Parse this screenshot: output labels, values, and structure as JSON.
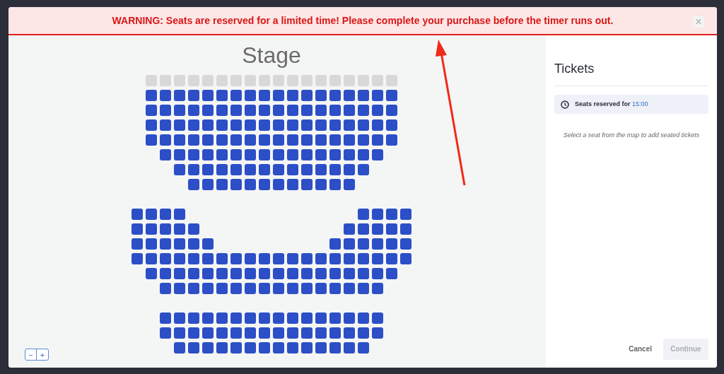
{
  "banner": {
    "message": "WARNING: Seats are reserved for a limited time! Please complete your purchase before the timer runs out.",
    "close": "×"
  },
  "seat_map": {
    "title": "Stage",
    "sections": [
      {
        "rows": [
          [
            {
              "kind": "seat",
              "available": false
            },
            {
              "kind": "seat",
              "available": false
            },
            {
              "kind": "seat",
              "available": false
            },
            {
              "kind": "seat",
              "available": false
            },
            {
              "kind": "seat",
              "available": false
            },
            {
              "kind": "seat",
              "available": false
            },
            {
              "kind": "seat",
              "available": false
            },
            {
              "kind": "seat",
              "available": false
            },
            {
              "kind": "seat",
              "available": false
            },
            {
              "kind": "seat",
              "available": false
            },
            {
              "kind": "seat",
              "available": false
            },
            {
              "kind": "seat",
              "available": false
            },
            {
              "kind": "seat",
              "available": false
            },
            {
              "kind": "seat",
              "available": false
            },
            {
              "kind": "seat",
              "available": false
            },
            {
              "kind": "seat",
              "available": false
            },
            {
              "kind": "seat",
              "available": false
            },
            {
              "kind": "seat",
              "available": false
            }
          ],
          [
            {
              "kind": "seat",
              "available": true
            },
            {
              "kind": "seat",
              "available": true
            },
            {
              "kind": "seat",
              "available": true
            },
            {
              "kind": "seat",
              "available": true
            },
            {
              "kind": "seat",
              "available": true
            },
            {
              "kind": "seat",
              "available": true
            },
            {
              "kind": "seat",
              "available": true
            },
            {
              "kind": "seat",
              "available": true
            },
            {
              "kind": "seat",
              "available": true
            },
            {
              "kind": "seat",
              "available": true
            },
            {
              "kind": "seat",
              "available": true
            },
            {
              "kind": "seat",
              "available": true
            },
            {
              "kind": "seat",
              "available": true
            },
            {
              "kind": "seat",
              "available": true
            },
            {
              "kind": "seat",
              "available": true
            },
            {
              "kind": "seat",
              "available": true
            },
            {
              "kind": "seat",
              "available": true
            },
            {
              "kind": "seat",
              "available": true
            }
          ],
          [
            {
              "kind": "seat",
              "available": true
            },
            {
              "kind": "seat",
              "available": true
            },
            {
              "kind": "seat",
              "available": true
            },
            {
              "kind": "seat",
              "available": true
            },
            {
              "kind": "seat",
              "available": true
            },
            {
              "kind": "seat",
              "available": true
            },
            {
              "kind": "seat",
              "available": true
            },
            {
              "kind": "seat",
              "available": true
            },
            {
              "kind": "seat",
              "available": true
            },
            {
              "kind": "seat",
              "available": true
            },
            {
              "kind": "seat",
              "available": true
            },
            {
              "kind": "seat",
              "available": true
            },
            {
              "kind": "seat",
              "available": true
            },
            {
              "kind": "seat",
              "available": true
            },
            {
              "kind": "seat",
              "available": true
            },
            {
              "kind": "seat",
              "available": true
            },
            {
              "kind": "seat",
              "available": true
            },
            {
              "kind": "seat",
              "available": true
            }
          ],
          [
            {
              "kind": "seat",
              "available": true
            },
            {
              "kind": "seat",
              "available": true
            },
            {
              "kind": "seat",
              "available": true
            },
            {
              "kind": "seat",
              "available": true
            },
            {
              "kind": "seat",
              "available": true
            },
            {
              "kind": "seat",
              "available": true
            },
            {
              "kind": "seat",
              "available": true
            },
            {
              "kind": "seat",
              "available": true
            },
            {
              "kind": "seat",
              "available": true
            },
            {
              "kind": "seat",
              "available": true
            },
            {
              "kind": "seat",
              "available": true
            },
            {
              "kind": "seat",
              "available": true
            },
            {
              "kind": "seat",
              "available": true
            },
            {
              "kind": "seat",
              "available": true
            },
            {
              "kind": "seat",
              "available": true
            },
            {
              "kind": "seat",
              "available": true
            },
            {
              "kind": "seat",
              "available": true
            },
            {
              "kind": "seat",
              "available": true
            }
          ],
          [
            {
              "kind": "seat",
              "available": true
            },
            {
              "kind": "seat",
              "available": true
            },
            {
              "kind": "seat",
              "available": true
            },
            {
              "kind": "seat",
              "available": true
            },
            {
              "kind": "seat",
              "available": true
            },
            {
              "kind": "seat",
              "available": true
            },
            {
              "kind": "seat",
              "available": true
            },
            {
              "kind": "seat",
              "available": true
            },
            {
              "kind": "seat",
              "available": true
            },
            {
              "kind": "seat",
              "available": true
            },
            {
              "kind": "seat",
              "available": true
            },
            {
              "kind": "seat",
              "available": true
            },
            {
              "kind": "seat",
              "available": true
            },
            {
              "kind": "seat",
              "available": true
            },
            {
              "kind": "seat",
              "available": true
            },
            {
              "kind": "seat",
              "available": true
            },
            {
              "kind": "seat",
              "available": true
            },
            {
              "kind": "seat",
              "available": true
            }
          ],
          [
            {
              "kind": "seat",
              "available": true
            },
            {
              "kind": "seat",
              "available": true
            },
            {
              "kind": "seat",
              "available": true
            },
            {
              "kind": "seat",
              "available": true
            },
            {
              "kind": "seat",
              "available": true
            },
            {
              "kind": "seat",
              "available": true
            },
            {
              "kind": "seat",
              "available": true
            },
            {
              "kind": "seat",
              "available": true
            },
            {
              "kind": "seat",
              "available": true
            },
            {
              "kind": "seat",
              "available": true
            },
            {
              "kind": "seat",
              "available": true
            },
            {
              "kind": "seat",
              "available": true
            },
            {
              "kind": "seat",
              "available": true
            },
            {
              "kind": "seat",
              "available": true
            },
            {
              "kind": "seat",
              "available": true
            },
            {
              "kind": "seat",
              "available": true
            }
          ],
          [
            {
              "kind": "seat",
              "available": true
            },
            {
              "kind": "seat",
              "available": true
            },
            {
              "kind": "seat",
              "available": true
            },
            {
              "kind": "seat",
              "available": true
            },
            {
              "kind": "seat",
              "available": true
            },
            {
              "kind": "seat",
              "available": true
            },
            {
              "kind": "seat",
              "available": true
            },
            {
              "kind": "seat",
              "available": true
            },
            {
              "kind": "seat",
              "available": true
            },
            {
              "kind": "seat",
              "available": true
            },
            {
              "kind": "seat",
              "available": true
            },
            {
              "kind": "seat",
              "available": true
            },
            {
              "kind": "seat",
              "available": true
            },
            {
              "kind": "seat",
              "available": true
            }
          ],
          [
            {
              "kind": "seat",
              "available": true
            },
            {
              "kind": "seat",
              "available": true
            },
            {
              "kind": "seat",
              "available": true
            },
            {
              "kind": "seat",
              "available": true
            },
            {
              "kind": "seat",
              "available": true
            },
            {
              "kind": "seat",
              "available": true
            },
            {
              "kind": "seat",
              "available": true
            },
            {
              "kind": "seat",
              "available": true
            },
            {
              "kind": "seat",
              "available": true
            },
            {
              "kind": "seat",
              "available": true
            },
            {
              "kind": "seat",
              "available": true
            },
            {
              "kind": "seat",
              "available": true
            }
          ]
        ]
      },
      {
        "rows": [
          [
            {
              "kind": "seat",
              "available": true
            },
            {
              "kind": "seat",
              "available": true
            },
            {
              "kind": "seat",
              "available": true
            },
            {
              "kind": "seat",
              "available": true
            },
            {
              "kind": "aisle"
            },
            {
              "kind": "aisle"
            },
            {
              "kind": "aisle"
            },
            {
              "kind": "aisle"
            },
            {
              "kind": "aisle"
            },
            {
              "kind": "aisle"
            },
            {
              "kind": "aisle"
            },
            {
              "kind": "aisle"
            },
            {
              "kind": "aisle"
            },
            {
              "kind": "aisle"
            },
            {
              "kind": "aisle"
            },
            {
              "kind": "aisle"
            },
            {
              "kind": "seat",
              "available": true
            },
            {
              "kind": "seat",
              "available": true
            },
            {
              "kind": "seat",
              "available": true
            },
            {
              "kind": "seat",
              "available": true
            }
          ],
          [
            {
              "kind": "seat",
              "available": true
            },
            {
              "kind": "seat",
              "available": true
            },
            {
              "kind": "seat",
              "available": true
            },
            {
              "kind": "seat",
              "available": true
            },
            {
              "kind": "seat",
              "available": true
            },
            {
              "kind": "aisle"
            },
            {
              "kind": "aisle"
            },
            {
              "kind": "aisle"
            },
            {
              "kind": "aisle"
            },
            {
              "kind": "aisle"
            },
            {
              "kind": "aisle"
            },
            {
              "kind": "aisle"
            },
            {
              "kind": "aisle"
            },
            {
              "kind": "aisle"
            },
            {
              "kind": "aisle"
            },
            {
              "kind": "seat",
              "available": true
            },
            {
              "kind": "seat",
              "available": true
            },
            {
              "kind": "seat",
              "available": true
            },
            {
              "kind": "seat",
              "available": true
            },
            {
              "kind": "seat",
              "available": true
            }
          ],
          [
            {
              "kind": "seat",
              "available": true
            },
            {
              "kind": "seat",
              "available": true
            },
            {
              "kind": "seat",
              "available": true
            },
            {
              "kind": "seat",
              "available": true
            },
            {
              "kind": "seat",
              "available": true
            },
            {
              "kind": "seat",
              "available": true
            },
            {
              "kind": "aisle"
            },
            {
              "kind": "aisle"
            },
            {
              "kind": "aisle"
            },
            {
              "kind": "aisle"
            },
            {
              "kind": "aisle"
            },
            {
              "kind": "aisle"
            },
            {
              "kind": "aisle"
            },
            {
              "kind": "aisle"
            },
            {
              "kind": "seat",
              "available": true
            },
            {
              "kind": "seat",
              "available": true
            },
            {
              "kind": "seat",
              "available": true
            },
            {
              "kind": "seat",
              "available": true
            },
            {
              "kind": "seat",
              "available": true
            },
            {
              "kind": "seat",
              "available": true
            }
          ],
          [
            {
              "kind": "seat",
              "available": true
            },
            {
              "kind": "seat",
              "available": true
            },
            {
              "kind": "seat",
              "available": true
            },
            {
              "kind": "seat",
              "available": true
            },
            {
              "kind": "seat",
              "available": true
            },
            {
              "kind": "seat",
              "available": true
            },
            {
              "kind": "seat",
              "available": true
            },
            {
              "kind": "seat",
              "available": true
            },
            {
              "kind": "seat",
              "available": true
            },
            {
              "kind": "seat",
              "available": true
            },
            {
              "kind": "seat",
              "available": true
            },
            {
              "kind": "seat",
              "available": true
            },
            {
              "kind": "seat",
              "available": true
            },
            {
              "kind": "seat",
              "available": true
            },
            {
              "kind": "seat",
              "available": true
            },
            {
              "kind": "seat",
              "available": true
            },
            {
              "kind": "seat",
              "available": true
            },
            {
              "kind": "seat",
              "available": true
            },
            {
              "kind": "seat",
              "available": true
            },
            {
              "kind": "seat",
              "available": true
            }
          ],
          [
            {
              "kind": "seat",
              "available": true
            },
            {
              "kind": "seat",
              "available": true
            },
            {
              "kind": "seat",
              "available": true
            },
            {
              "kind": "seat",
              "available": true
            },
            {
              "kind": "seat",
              "available": true
            },
            {
              "kind": "seat",
              "available": true
            },
            {
              "kind": "seat",
              "available": true
            },
            {
              "kind": "seat",
              "available": true
            },
            {
              "kind": "seat",
              "available": true
            },
            {
              "kind": "seat",
              "available": true
            },
            {
              "kind": "seat",
              "available": true
            },
            {
              "kind": "seat",
              "available": true
            },
            {
              "kind": "seat",
              "available": true
            },
            {
              "kind": "seat",
              "available": true
            },
            {
              "kind": "seat",
              "available": true
            },
            {
              "kind": "seat",
              "available": true
            },
            {
              "kind": "seat",
              "available": true
            },
            {
              "kind": "seat",
              "available": true
            }
          ],
          [
            {
              "kind": "seat",
              "available": true
            },
            {
              "kind": "seat",
              "available": true
            },
            {
              "kind": "seat",
              "available": true
            },
            {
              "kind": "seat",
              "available": true
            },
            {
              "kind": "seat",
              "available": true
            },
            {
              "kind": "seat",
              "available": true
            },
            {
              "kind": "seat",
              "available": true
            },
            {
              "kind": "seat",
              "available": true
            },
            {
              "kind": "seat",
              "available": true
            },
            {
              "kind": "seat",
              "available": true
            },
            {
              "kind": "seat",
              "available": true
            },
            {
              "kind": "seat",
              "available": true
            },
            {
              "kind": "seat",
              "available": true
            },
            {
              "kind": "seat",
              "available": true
            },
            {
              "kind": "seat",
              "available": true
            },
            {
              "kind": "seat",
              "available": true
            }
          ]
        ]
      },
      {
        "rows": [
          [
            {
              "kind": "seat",
              "available": true
            },
            {
              "kind": "seat",
              "available": true
            },
            {
              "kind": "seat",
              "available": true
            },
            {
              "kind": "seat",
              "available": true
            },
            {
              "kind": "seat",
              "available": true
            },
            {
              "kind": "seat",
              "available": true
            },
            {
              "kind": "seat",
              "available": true
            },
            {
              "kind": "seat",
              "available": true
            },
            {
              "kind": "seat",
              "available": true
            },
            {
              "kind": "seat",
              "available": true
            },
            {
              "kind": "seat",
              "available": true
            },
            {
              "kind": "seat",
              "available": true
            },
            {
              "kind": "seat",
              "available": true
            },
            {
              "kind": "seat",
              "available": true
            },
            {
              "kind": "seat",
              "available": true
            },
            {
              "kind": "seat",
              "available": true
            }
          ],
          [
            {
              "kind": "seat",
              "available": true
            },
            {
              "kind": "seat",
              "available": true
            },
            {
              "kind": "seat",
              "available": true
            },
            {
              "kind": "seat",
              "available": true
            },
            {
              "kind": "seat",
              "available": true
            },
            {
              "kind": "seat",
              "available": true
            },
            {
              "kind": "seat",
              "available": true
            },
            {
              "kind": "seat",
              "available": true
            },
            {
              "kind": "seat",
              "available": true
            },
            {
              "kind": "seat",
              "available": true
            },
            {
              "kind": "seat",
              "available": true
            },
            {
              "kind": "seat",
              "available": true
            },
            {
              "kind": "seat",
              "available": true
            },
            {
              "kind": "seat",
              "available": true
            },
            {
              "kind": "seat",
              "available": true
            },
            {
              "kind": "seat",
              "available": true
            }
          ],
          [
            {
              "kind": "seat",
              "available": true
            },
            {
              "kind": "seat",
              "available": true
            },
            {
              "kind": "seat",
              "available": true
            },
            {
              "kind": "seat",
              "available": true
            },
            {
              "kind": "seat",
              "available": true
            },
            {
              "kind": "seat",
              "available": true
            },
            {
              "kind": "seat",
              "available": true
            },
            {
              "kind": "seat",
              "available": true
            },
            {
              "kind": "seat",
              "available": true
            },
            {
              "kind": "seat",
              "available": true
            },
            {
              "kind": "seat",
              "available": true
            },
            {
              "kind": "seat",
              "available": true
            },
            {
              "kind": "seat",
              "available": true
            },
            {
              "kind": "seat",
              "available": true
            }
          ]
        ]
      }
    ],
    "zoom_out": "−",
    "zoom_in": "+"
  },
  "tickets": {
    "title": "Tickets",
    "timer_label": "Seats reserved for",
    "timer_value": "15:00",
    "hint": "Select a seat from the map to add seated tickets",
    "cancel": "Cancel",
    "continue": {
      "label": "Continue",
      "disabled": true
    }
  }
}
